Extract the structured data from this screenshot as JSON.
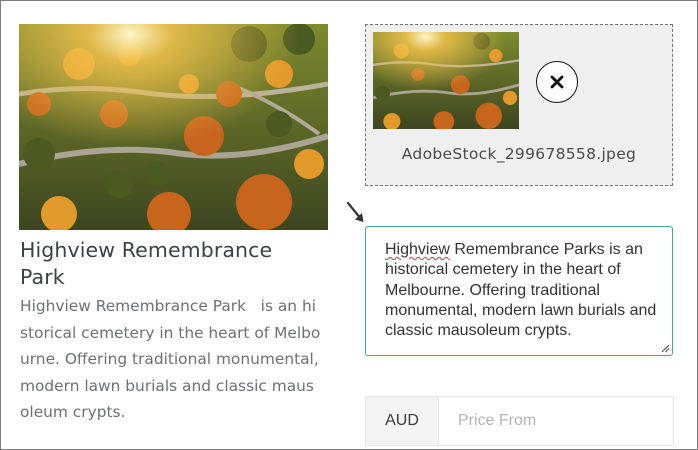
{
  "card": {
    "title": "Highview Remembrance Park",
    "description": "Highview Remembrance Park   is an historical cemetery in the heart of Melbourne. Offering traditional monumental, modern lawn burials and classic mausoleum crypts."
  },
  "upload": {
    "filename": "AdobeStock_299678558.jpeg",
    "remove_icon": "close-icon"
  },
  "description_field": {
    "first_word": "Highview",
    "rest": " Remembrance Parks is an historical cemetery in the heart of Melbourne. Offering traditional monumental, modern lawn burials and classic mausoleum crypts."
  },
  "price": {
    "currency": "AUD",
    "placeholder": "Price From",
    "value": ""
  },
  "colors": {
    "accent_border": "#3fa7a4",
    "upload_bg": "#efefef"
  },
  "icons": [
    "close-icon",
    "arrow-pointer-icon",
    "resize-grip-icon"
  ]
}
